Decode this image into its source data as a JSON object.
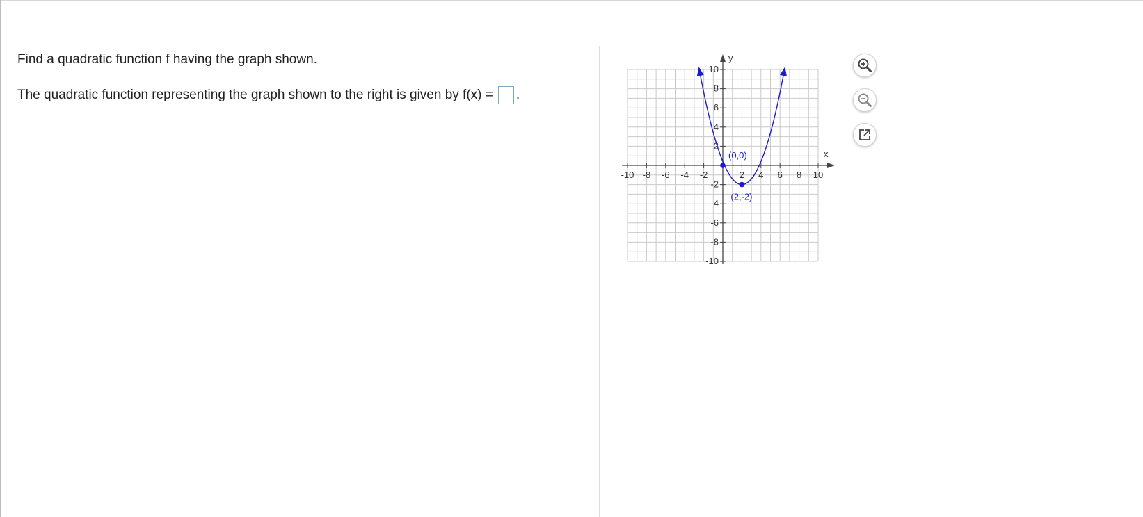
{
  "question": {
    "prompt": "Find a quadratic function f having the graph shown.",
    "answer_prefix": "The quadratic function representing the graph shown to the right is given by f(x) =",
    "answer_value": "",
    "answer_suffix": "."
  },
  "graph": {
    "x_axis_label": "x",
    "y_axis_label": "y",
    "x_tick_labels": [
      "-10",
      "-8",
      "-6",
      "-4",
      "-2",
      "2",
      "4",
      "6",
      "8",
      "10"
    ],
    "y_tick_labels": [
      "10",
      "8",
      "6",
      "4",
      "2",
      "-2",
      "-4",
      "-6",
      "-8",
      "-10"
    ],
    "points": [
      {
        "label": "(0,0)",
        "x": 0,
        "y": 0
      },
      {
        "label": "(2,-2)",
        "x": 2,
        "y": -2
      }
    ],
    "xlim": [
      -10,
      10
    ],
    "ylim": [
      -10,
      10
    ],
    "curve_color": "#1a1ad6",
    "grid_color": "#c9c9c9"
  },
  "chart_data": {
    "type": "line",
    "title": "",
    "xlabel": "x",
    "ylabel": "y",
    "xlim": [
      -10,
      10
    ],
    "ylim": [
      -10,
      10
    ],
    "grid": true,
    "series": [
      {
        "x": [
          -2.47,
          -2,
          -1,
          0,
          1,
          2,
          3,
          4,
          5,
          6,
          6.47
        ],
        "y": [
          10,
          8,
          3,
          0,
          -1.5,
          -2,
          -1.5,
          0,
          2.5,
          6,
          10
        ]
      }
    ],
    "annotations": [
      "(0,0)",
      "(2,-2)"
    ]
  },
  "toolbar": {
    "zoom_in_icon": "zoom-in-icon",
    "zoom_out_icon": "zoom-out-icon",
    "popout_icon": "popout-icon"
  }
}
